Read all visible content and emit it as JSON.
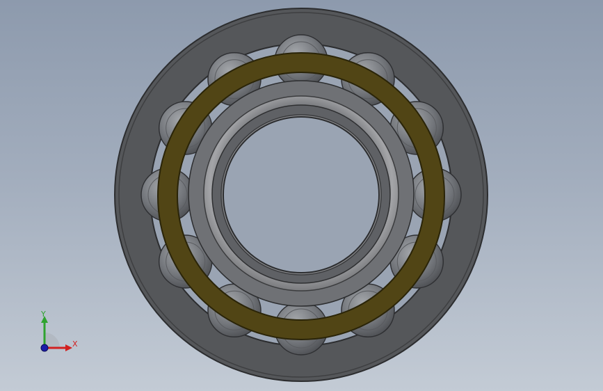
{
  "viewport": {
    "background_top": "#8d9aad",
    "background_bottom": "#c3cbd5"
  },
  "model": {
    "outer_ring_color": "#5a5b5d",
    "cage_color": "#4f4413",
    "roller_color": "#74777c",
    "inner_ring_color": "#8c8d90",
    "roller_count": 12
  },
  "triad": {
    "y_label": "Y",
    "x_label": "X",
    "y_color": "#2fa32f",
    "x_color": "#d22020",
    "z_color": "#1c1ca8"
  }
}
